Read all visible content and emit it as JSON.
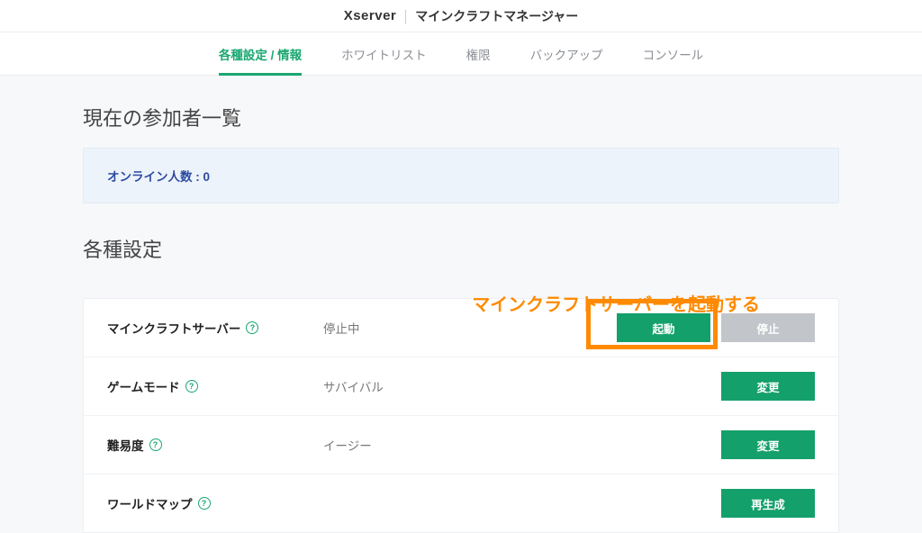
{
  "header": {
    "brand": "Xserver",
    "subtitle": "マインクラフトマネージャー"
  },
  "tabs": [
    "各種設定 / 情報",
    "ホワイトリスト",
    "権限",
    "バックアップ",
    "コンソール"
  ],
  "participants": {
    "title": "現在の参加者一覧",
    "online_label": "オンライン人数 : 0"
  },
  "annotation": "マインクラフトサーバーを起動する",
  "settings": {
    "title": "各種設定",
    "rows": [
      {
        "label": "マインクラフトサーバー",
        "value": "停止中",
        "buttons": [
          {
            "text": "起動",
            "style": "green"
          },
          {
            "text": "停止",
            "style": "gray"
          }
        ]
      },
      {
        "label": "ゲームモード",
        "value": "サバイバル",
        "buttons": [
          {
            "text": "変更",
            "style": "green"
          }
        ]
      },
      {
        "label": "難易度",
        "value": "イージー",
        "buttons": [
          {
            "text": "変更",
            "style": "green"
          }
        ]
      },
      {
        "label": "ワールドマップ",
        "value": "",
        "buttons": [
          {
            "text": "再生成",
            "style": "green"
          }
        ]
      }
    ]
  }
}
